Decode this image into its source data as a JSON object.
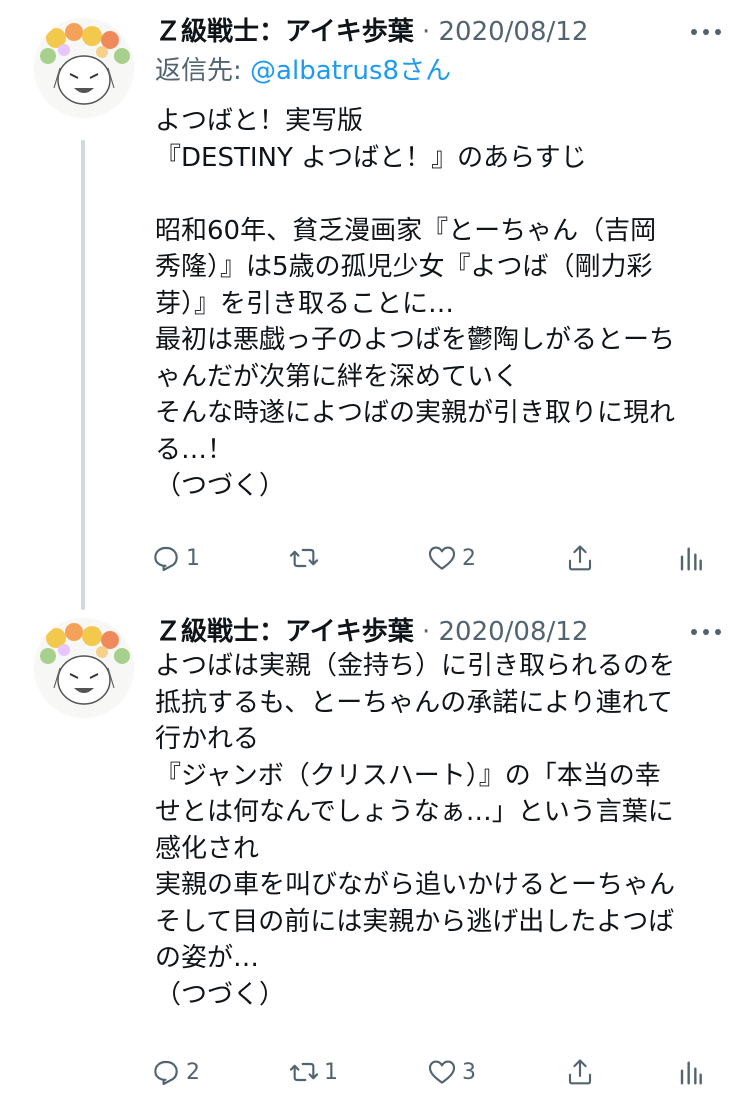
{
  "tweets": [
    {
      "author": "Ｚ級戦士：アイキ歩葉",
      "separator": "·",
      "date": "2020/08/12",
      "reply_prefix": "返信先: ",
      "reply_handle": "@albatrus8さん",
      "lines": [
        "よつばと！実写版",
        "『DESTINY よつばと！』のあらすじ",
        "",
        "昭和60年、貧乏漫画家『とーちゃん（吉岡",
        "秀隆）』は5歳の孤児少女『よつば（剛力彩",
        "芽）』を引き取ることに…",
        "最初は悪戯っ子のよつばを鬱陶しがるとーち",
        "ゃんだが次第に絆を深めていく",
        "そんな時遂によつばの実親が引き取りに現れ",
        "る…！",
        "（つづく）"
      ],
      "replies": "1",
      "retweets": "",
      "likes": "2"
    },
    {
      "author": "Ｚ級戦士：アイキ歩葉",
      "separator": "·",
      "date": "2020/08/12",
      "lines": [
        "よつばは実親（金持ち）に引き取られるのを",
        "抵抗するも、とーちゃんの承諾により連れて",
        "行かれる",
        "『ジャンボ（クリスハート）』の「本当の幸",
        "せとは何なんでしょうなぁ…」という言葉に",
        "感化され",
        "実親の車を叫びながら追いかけるとーちゃん",
        "そして目の前には実親から逃げ出したよつば",
        "の姿が…",
        "（つづく）"
      ],
      "replies": "2",
      "retweets": "1",
      "likes": "3"
    }
  ],
  "icons": {
    "more": "more-icon",
    "reply": "reply-icon",
    "retweet": "retweet-icon",
    "like": "heart-icon",
    "share": "share-icon",
    "stats": "analytics-icon"
  },
  "colors": {
    "text": "#0f1419",
    "muted": "#536471",
    "link": "#1d9bf0",
    "thread_line": "#cfd9de"
  }
}
